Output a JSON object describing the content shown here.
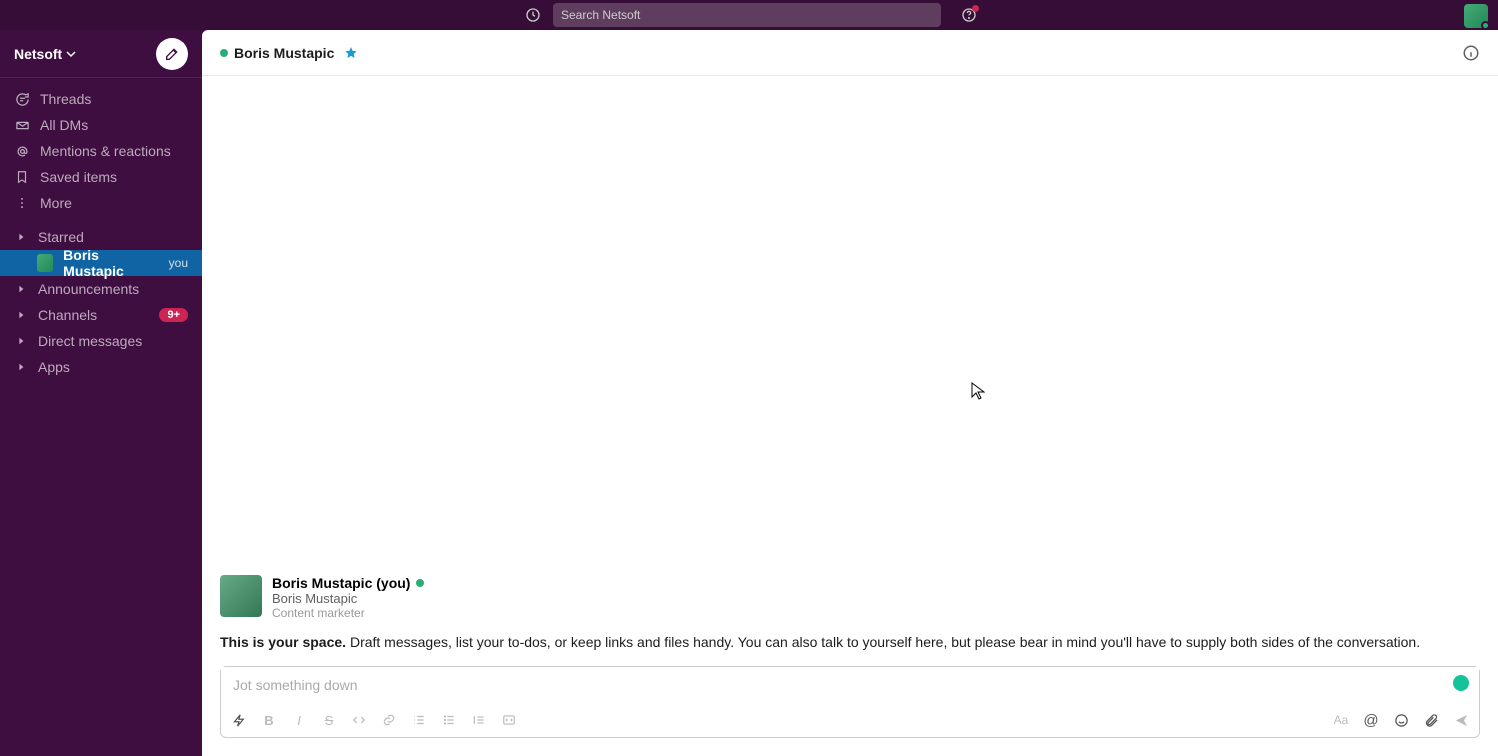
{
  "topbar": {
    "search_placeholder": "Search Netsoft"
  },
  "workspace": {
    "name": "Netsoft"
  },
  "sidebar": {
    "threads": "Threads",
    "all_dms": "All DMs",
    "mentions": "Mentions & reactions",
    "saved": "Saved items",
    "more": "More",
    "starred": "Starred",
    "self_name": "Boris Mustapic",
    "self_you": "you",
    "announcements": "Announcements",
    "channels": "Channels",
    "channels_badge": "9+",
    "dms": "Direct messages",
    "apps": "Apps"
  },
  "header": {
    "name": "Boris Mustapic"
  },
  "profile": {
    "name": "Boris Mustapic (you)",
    "sub": "Boris Mustapic",
    "role": "Content marketer"
  },
  "intro": {
    "bold": "This is your space.",
    "rest": " Draft messages, list your to-dos, or keep links and files handy. You can also talk to yourself here, but please bear in mind you'll have to supply both sides of the conversation."
  },
  "composer": {
    "placeholder": "Jot something down"
  }
}
